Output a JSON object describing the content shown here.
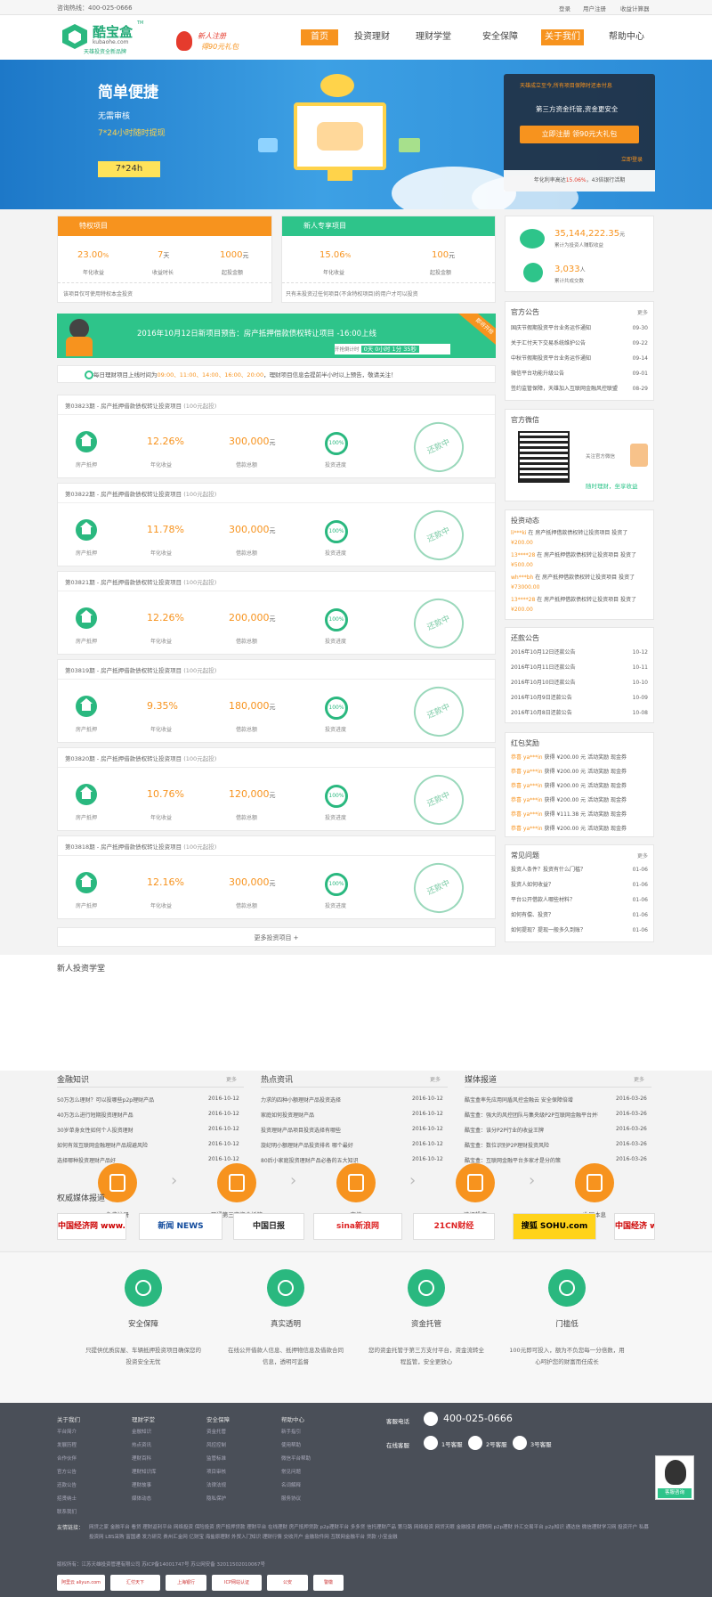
{
  "topbar": {
    "hotline": "咨询热线：400-025-0666",
    "login": "登录",
    "register": "用户注册",
    "calculator": "收益计算器"
  },
  "header": {
    "logo_name": "酷宝盒",
    "logo_domain": "kubaohe.com",
    "logo_tm": "TM",
    "logo_slogan": "天雄投资全新品牌",
    "promo_line1": "新人注册",
    "promo_line2": "得90元礼包"
  },
  "nav": [
    "首页",
    "投资理财",
    "理财学堂",
    "安全保障",
    "关于我们",
    "帮助中心"
  ],
  "banner": {
    "title": "简单便捷",
    "line1": "无需审核",
    "line2": "7*24小时随时提现",
    "badge": "7*24h",
    "panel_top": "天雄成立至今,所有项目保障时还本付息",
    "panel_mid": "第三方资金托管,资金更安全",
    "register_btn": "立即注册  领90元大礼包",
    "login_link": "立即登录",
    "panel_bottom_a": "年化利率高达",
    "panel_bottom_rate": "15.06%",
    "panel_bottom_b": "，43倍银行活期"
  },
  "products": [
    {
      "name": "特权项目",
      "rate": "23.00",
      "rate_unit": "%",
      "days": "7",
      "days_unit": "天",
      "min": "1000",
      "min_unit": "元",
      "l1": "年化收益",
      "l2": "收益时长",
      "l3": "起投金额",
      "note": "该项目仅可使用特权本金投资"
    },
    {
      "name": "新人专享项目",
      "rate": "15.06",
      "rate_unit": "%",
      "min": "100",
      "min_unit": "元",
      "l1": "年化收益",
      "l3": "起投金额",
      "note": "只有未投资过任何项目(不含特权项目)的用户才可以投资"
    }
  ],
  "stats": {
    "total": "35,144,222.35",
    "total_unit": "元",
    "total_label": "累计为投资人赚取收益",
    "users": "3,033",
    "users_unit": "人",
    "users_label": "累计共成交数"
  },
  "announce": {
    "title": "2016年10月12日新项目预告：房产抵押借款债权转让项目 -16:00上线",
    "countdown_label": "开抢倒计时",
    "countdown": "0天 0小时 1分 35秒",
    "ribbon": "即将开抢",
    "schedule_a": "每日理财项目上线时间为",
    "schedule_times": "09:00、11:00、14:00、16:00、20:00",
    "schedule_b": "，理财项目信息会提前半小时以上预告，敬请关注！"
  },
  "tenders": [
    {
      "id": "第03823期",
      "title": "房产抵押借款债权转让投资项目",
      "min": "(100元起投)",
      "rate": "12.26%",
      "amount": "300,000"
    },
    {
      "id": "第03822期",
      "title": "房产抵押借款债权转让投资项目",
      "min": "(100元起投)",
      "rate": "11.78%",
      "amount": "300,000"
    },
    {
      "id": "第03821期",
      "title": "房产抵押借款债权转让投资项目",
      "min": "(100元起投)",
      "rate": "12.26%",
      "amount": "200,000"
    },
    {
      "id": "第03819期",
      "title": "房产抵押借款债权转让投资项目",
      "min": "(100元起投)",
      "rate": "9.35%",
      "amount": "180,000"
    },
    {
      "id": "第03820期",
      "title": "房产抵押借款债权转让投资项目",
      "min": "(100元起投)",
      "rate": "10.76%",
      "amount": "120,000"
    },
    {
      "id": "第03818期",
      "title": "房产抵押借款债权转让投资项目",
      "min": "(100元起投)",
      "rate": "12.16%",
      "amount": "300,000"
    }
  ],
  "tender_labels": {
    "house": "房产抵押",
    "rate": "年化收益",
    "amount": "借款总额",
    "progress": "投资进度",
    "progress_val": "100%",
    "stamp": "还款中",
    "unit": "元"
  },
  "more_projects": "更多投资项目 +",
  "notices": {
    "title": "官方公告",
    "more": "更多",
    "items": [
      {
        "t": "国庆节假期投资平台业务运作通知",
        "d": "09-30"
      },
      {
        "t": "关于汇付天下交易系统维护公告",
        "d": "09-22"
      },
      {
        "t": "中秋节假期投资平台业务运作通知",
        "d": "09-14"
      },
      {
        "t": "微信平台功能升级公告",
        "d": "09-01"
      },
      {
        "t": "签约监管保障，天雄加入互联网金融风控联盟",
        "d": "08-29"
      }
    ]
  },
  "wechat": {
    "title": "官方微信",
    "text1": "关注官方微信",
    "text2": "随时理财，坐享收益"
  },
  "invest_dyn": {
    "title": "投资动态",
    "items": [
      {
        "u": "li***ki",
        "t": "在 房产抵押借款债权转让投资项目 投资了",
        "a": "¥200.00"
      },
      {
        "u": "13****28",
        "t": "在 房产抵押借款债权转让投资项目 投资了",
        "a": "¥500.00"
      },
      {
        "u": "wh***bh",
        "t": "在 房产抵押借款债权转让投资项目 投资了",
        "a": "¥73000.00"
      },
      {
        "u": "13****28",
        "t": "在 房产抵押借款债权转让投资项目 投资了",
        "a": "¥200.00"
      }
    ]
  },
  "repay": {
    "title": "还款公告",
    "items": [
      {
        "t": "2016年10月12日还款公告",
        "d": "10-12"
      },
      {
        "t": "2016年10月11日还款公告",
        "d": "10-11"
      },
      {
        "t": "2016年10月10日还款公告",
        "d": "10-10"
      },
      {
        "t": "2016年10月9日还款公告",
        "d": "10-09"
      },
      {
        "t": "2016年10月8日还款公告",
        "d": "10-08"
      }
    ]
  },
  "redpack": {
    "title": "红包奖励",
    "items": [
      {
        "u": "恭喜 ya***in",
        "a": "获得 ¥200.00 元 活动奖励 现金券"
      },
      {
        "u": "恭喜 ya***in",
        "a": "获得 ¥200.00 元 活动奖励 现金券"
      },
      {
        "u": "恭喜 ya***in",
        "a": "获得 ¥200.00 元 活动奖励 现金券"
      },
      {
        "u": "恭喜 ya***in",
        "a": "获得 ¥200.00 元 活动奖励 现金券"
      },
      {
        "u": "恭喜 ya***in",
        "a": "获得 ¥111.38 元 活动奖励 现金券"
      },
      {
        "u": "恭喜 ya***in",
        "a": "获得 ¥200.00 元 活动奖励 现金券"
      }
    ]
  },
  "faq": {
    "title": "常见问题",
    "more": "更多",
    "items": [
      {
        "t": "投资人条件？投资有什么门槛？",
        "d": "01-06"
      },
      {
        "t": "投资人如何收益？",
        "d": "01-06"
      },
      {
        "t": "平台公开借款人哪些材料？",
        "d": "01-06"
      },
      {
        "t": "如何有偿、投资？",
        "d": "01-06"
      },
      {
        "t": "如何提现？提现一般多久到账？",
        "d": "01-06"
      }
    ]
  },
  "school": {
    "title": "新人投资学堂",
    "steps": [
      "免费注册",
      "开通第三方资金托管",
      "充值",
      "选择投资",
      "收回本息"
    ]
  },
  "news_cols": [
    {
      "title": "金融知识",
      "more": "更多",
      "items": [
        {
          "t": "50万怎么理财？可以投哪些p2p理财产品",
          "d": "2016-10-12"
        },
        {
          "t": "40万怎么进行短期投资理财产品",
          "d": "2016-10-12"
        },
        {
          "t": "30岁单身女性如何个人投资理财",
          "d": "2016-10-12"
        },
        {
          "t": "如何有效互联网金融理财产品规避风险",
          "d": "2016-10-12"
        },
        {
          "t": "选择哪种投资理财产品好",
          "d": "2016-10-12"
        }
      ]
    },
    {
      "title": "热点资讯",
      "more": "更多",
      "items": [
        {
          "t": "力求的四种小额理财产品投资选择",
          "d": "2016-10-12"
        },
        {
          "t": "家庭如何投资理财产品",
          "d": "2016-10-12"
        },
        {
          "t": "投资理财产品项目投资选择有哪些",
          "d": "2016-10-12"
        },
        {
          "t": "旋纪明小额理财产品投资排名 哪个最好",
          "d": "2016-10-12"
        },
        {
          "t": "80后小家庭投资理财产品必备的五大知识",
          "d": "2016-10-12"
        }
      ]
    },
    {
      "title": "媒体报道",
      "more": "更多",
      "items": [
        {
          "t": "酷宝盒率先应用同盾风控金融云 安全保障倍增",
          "d": "2016-03-26"
        },
        {
          "t": "酷宝盒：强大的风控团队与集央级P2P互联网金融平台并存...",
          "d": "2016-03-26"
        },
        {
          "t": "酷宝盒：该分P2P行业的收益王牌",
          "d": "2016-03-26"
        },
        {
          "t": "酷宝盒：数位识别P2P理财投资风险",
          "d": "2016-03-26"
        },
        {
          "t": "酷宝盒：互联网金融平台多家才是分的策",
          "d": "2016-03-26"
        }
      ]
    }
  ],
  "media": {
    "title": "权威媒体报道",
    "logos": [
      "中国经济网 www.ce.cn",
      "新闻 NEWS",
      "中国日报",
      "sina新浪网",
      "21CN财经",
      "搜狐 SOHU.com",
      "中国经济 www.ce"
    ]
  },
  "features": [
    {
      "t": "安全保障",
      "d": "只提供优质房屋、车辆抵押投资项目确保您的投资安全无忧"
    },
    {
      "t": "真实透明",
      "d": "在线公开借款人信息、抵押物信息及借款合同信息，透明可监督"
    },
    {
      "t": "资金托管",
      "d": "您的资金托管于第三方支付平台，资金流转全程监管，安全更放心"
    },
    {
      "t": "门槛低",
      "d": "100元即可投入，额为不负您每一分倍数，用心呵护您的财富而任成长"
    }
  ],
  "footer": {
    "cols": [
      {
        "title": "关于我们",
        "items": [
          "平台简介",
          "发展历程",
          "合作伙伴",
          "官方公告",
          "还款公告",
          "招贤纳士",
          "联系我们"
        ]
      },
      {
        "title": "理财学堂",
        "items": [
          "金融知识",
          "热点资讯",
          "理财百科",
          "理财知识库",
          "理财故事",
          "媒体动态"
        ]
      },
      {
        "title": "安全保障",
        "items": [
          "资金托管",
          "风控控制",
          "监管标准",
          "项目审核",
          "法律法规",
          "隐私保护"
        ]
      },
      {
        "title": "帮助中心",
        "items": [
          "新手指引",
          "使用帮助",
          "微信平台帮助",
          "常见问题",
          "名词解释",
          "服务协议"
        ]
      }
    ],
    "phone_label": "客服电话",
    "phone": "400-025-0666",
    "online_label": "在线客服",
    "qq": [
      "1号客服",
      "2号客服",
      "3号客服"
    ],
    "links_label": "友情链接：",
    "links": "网贷之家  金融平台  看贷  理财返利平台  网络投资  保险投资  房产抵押贷款  理财平台  在线理财  房产抵押贷款  p2p理财平台  多多贷  信托理财产品  第马路  网络投资  网贷天眼  金融投资  超财网  p2p理财  外汇交易平台  p2p知识  通达信  微信理财学习网  投资开户  私募投资网  LBS采购  富国通  发力研究  贵州汇金网  亿财宝  海盐原理财  外贸入门知识  理财行情  交收开户  金融软件网  互联网金融平台  贷款  小宝金融",
    "copyright": "版权所有：江苏天雄投资管理有限公司 苏ICP备14001747号   苏公网安备 32011502010067号",
    "help_label": "客服咨询",
    "badges": [
      "阿里云 aliyun.com",
      "汇付天下",
      "上海银行",
      "ICP网站认证",
      "公安",
      "警徽"
    ]
  }
}
